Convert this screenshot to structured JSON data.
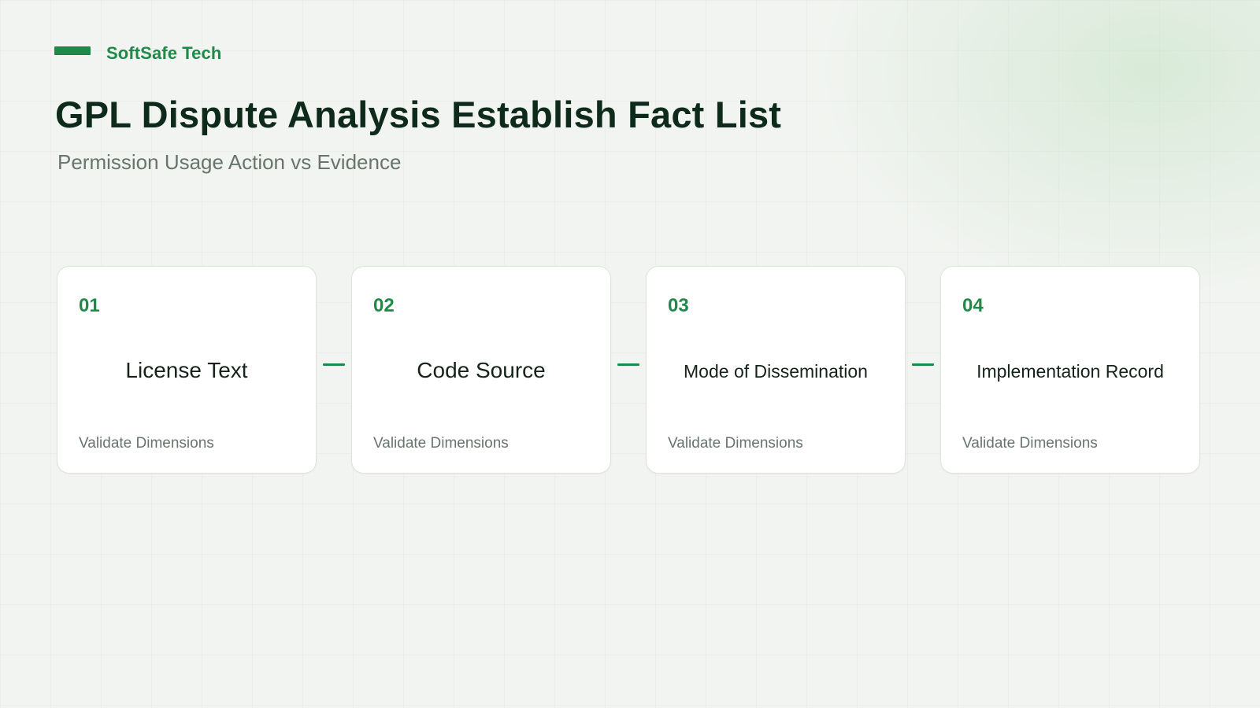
{
  "brand": {
    "name": "SoftSafe Tech"
  },
  "title": "GPL Dispute Analysis Establish Fact List",
  "subtitle": "Permission Usage Action vs Evidence",
  "cards": [
    {
      "number": "01",
      "title": "License Text",
      "footer": "Validate Dimensions"
    },
    {
      "number": "02",
      "title": "Code Source",
      "footer": "Validate Dimensions"
    },
    {
      "number": "03",
      "title": "Mode of Dissemination",
      "footer": "Validate Dimensions"
    },
    {
      "number": "04",
      "title": "Implementation Record",
      "footer": "Validate Dimensions"
    }
  ],
  "colors": {
    "accent": "#1e8a4a",
    "title": "#0e2a1a",
    "muted": "#67756c",
    "background": "#f2f4f1"
  }
}
